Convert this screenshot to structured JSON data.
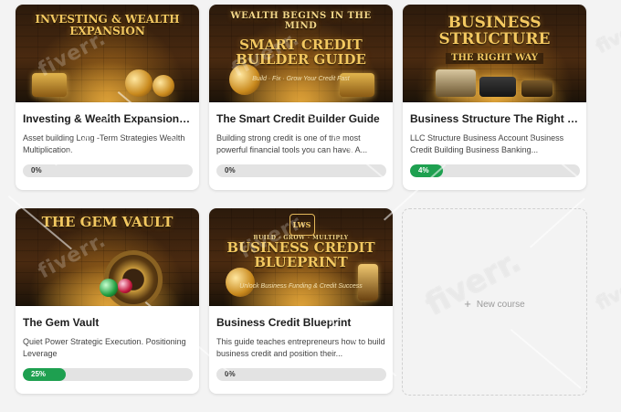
{
  "courses": [
    {
      "thumb_top": "",
      "thumb_title": "INVESTING & WEALTH",
      "thumb_title2": "EXPANSION",
      "thumb_sub": "",
      "title": "Investing & Wealth Expansion (Co...",
      "description": "Asset building Long -Term Strategies Wealth Multiplication.",
      "progress": 0,
      "progress_label": "0%"
    },
    {
      "thumb_top": "WEALTH BEGINS IN THE MIND",
      "thumb_title": "SMART CREDIT",
      "thumb_title2": "BUILDER GUIDE",
      "thumb_sub": "Build · Fix · Grow Your Credit Fast",
      "title": "The Smart Credit Builder Guide",
      "description": "Building strong credit is one of the most powerful financial tools you can have. A...",
      "progress": 0,
      "progress_label": "0%"
    },
    {
      "thumb_top": "",
      "thumb_title": "BUSINESS STRUCTURE",
      "thumb_title2": "THE RIGHT WAY",
      "thumb_sub": "",
      "title": "Business Structure The Right Way",
      "description": "LLC Structure Business Account Business Credit Building Business Banking...",
      "progress": 0.04,
      "progress_label": "4%"
    },
    {
      "thumb_top": "",
      "thumb_title": "THE GEM VAULT",
      "thumb_title2": "",
      "thumb_sub": "",
      "title": "The Gem Vault",
      "description": "Quiet Power Strategic Execution. Positioning Leverage",
      "progress": 0.25,
      "progress_label": "25%"
    },
    {
      "thumb_top": "BUILD · GROW · MULTIPLY",
      "thumb_logo": "LWS",
      "thumb_title": "BUSINESS CREDIT",
      "thumb_title2": "BLUEPRINT",
      "thumb_sub": "Unlock Business Funding & Credit Success",
      "title": "Business Credit Blueprint",
      "description": "This guide teaches entrepreneurs how to build business credit and position their...",
      "progress": 0,
      "progress_label": "0%"
    }
  ],
  "new_course": {
    "plus": "+",
    "label": "New course"
  },
  "watermark": "fiverr."
}
